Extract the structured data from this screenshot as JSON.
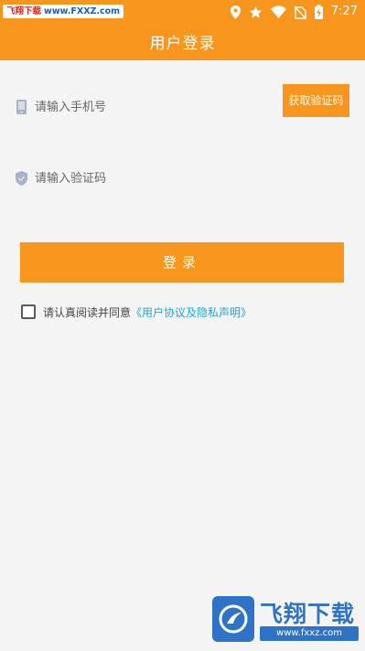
{
  "status_bar": {
    "watermark_left_red": "飞翔下载",
    "watermark_left_blue": "www.FXXZ.com",
    "time": "7:27",
    "icons": [
      "location-icon",
      "star-icon",
      "wifi-icon",
      "no-sim-icon",
      "battery-charging-icon"
    ]
  },
  "header": {
    "title": "用户登录"
  },
  "form": {
    "phone_placeholder": "请输入手机号",
    "phone_icon": "phone-icon",
    "code_placeholder": "请输入验证码",
    "code_icon": "shield-icon",
    "get_code_label": "获取验证码",
    "login_label": "登录",
    "agree_text": "请认真阅读并同意",
    "agree_link": "《用户协议及隐私声明》"
  },
  "watermark": {
    "brand": "飞翔下载",
    "url": "www.fxxz.com"
  },
  "colors": {
    "accent": "#f7951d",
    "link": "#1ea6dc",
    "background": "#f4f4f4"
  }
}
